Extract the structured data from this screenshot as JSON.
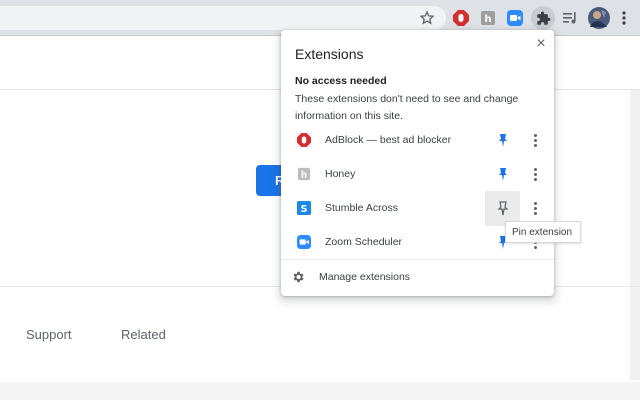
{
  "toolbar": {
    "icons": [
      "star-icon",
      "adblock-icon",
      "honey-icon",
      "zoom-icon",
      "extensions-puzzle-icon",
      "media-queue-icon",
      "profile-avatar",
      "menu-kebab-icon"
    ]
  },
  "page": {
    "button_text": "R",
    "links": [
      "Support",
      "Related"
    ],
    "accent_color": "#1a73e8"
  },
  "popup": {
    "title": "Extensions",
    "close_symbol": "×",
    "section_heading": "No access needed",
    "section_description": "These extensions don't need to see and change information on this site.",
    "extensions": [
      {
        "name": "AdBlock — best ad blocker",
        "icon": "adblock-icon",
        "pinned": true
      },
      {
        "name": "Honey",
        "icon": "honey-icon",
        "pinned": true
      },
      {
        "name": "Stumble Across",
        "icon": "stumble-across-icon",
        "pinned": false
      },
      {
        "name": "Zoom Scheduler",
        "icon": "zoom-icon",
        "pinned": true
      }
    ],
    "manage_label": "Manage extensions",
    "tooltip": "Pin extension",
    "pin_color": "#1a73e8"
  }
}
